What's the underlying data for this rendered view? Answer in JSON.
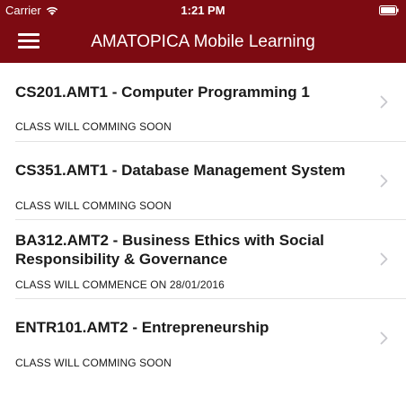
{
  "status_bar": {
    "carrier": "Carrier",
    "time": "1:21 PM",
    "wifi_icon": "wifi-icon",
    "battery_icon": "battery-icon"
  },
  "nav": {
    "menu_icon": "hamburger-menu-icon",
    "title": "AMATOPICA Mobile Learning",
    "color": "#7d0b12"
  },
  "courses": [
    {
      "title": "CS201.AMT1 - Computer Programming 1",
      "status": "CLASS WILL COMMING SOON"
    },
    {
      "title": "CS351.AMT1 - Database Management System",
      "status": "CLASS WILL COMMING SOON"
    },
    {
      "title": "BA312.AMT2 - Business Ethics with Social Responsibility & Governance",
      "status": "CLASS WILL COMMENCE ON 28/01/2016"
    },
    {
      "title": "ENTR101.AMT2 - Entrepreneurship",
      "status": "CLASS WILL COMMING SOON"
    }
  ]
}
